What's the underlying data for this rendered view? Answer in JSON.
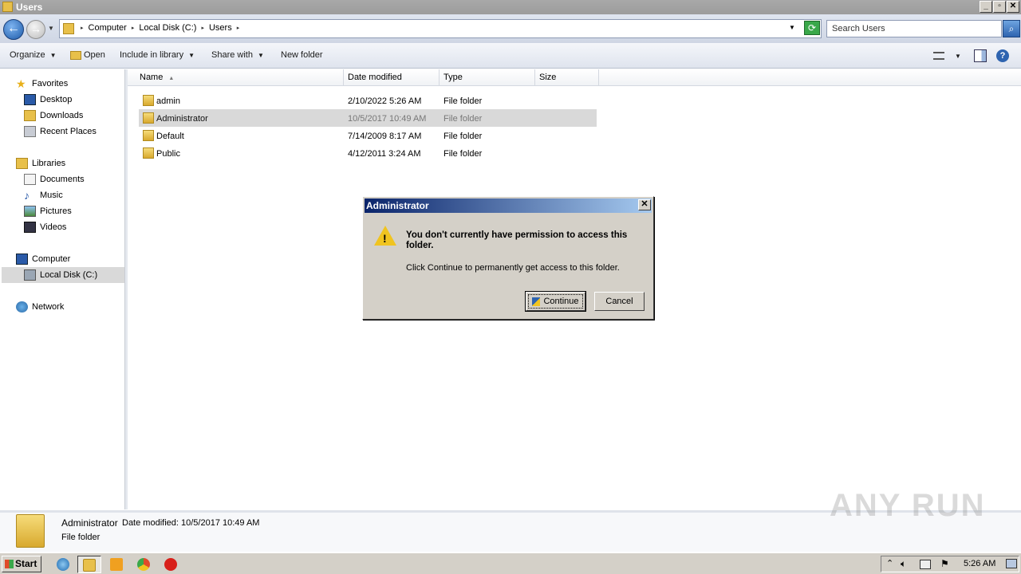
{
  "window": {
    "title": "Users"
  },
  "address": {
    "crumbs": [
      "Computer",
      "Local Disk (C:)",
      "Users"
    ]
  },
  "search": {
    "placeholder": "Search Users"
  },
  "toolbar": {
    "organize": "Organize",
    "open": "Open",
    "include_in_library": "Include in library",
    "share_with": "Share with",
    "new_folder": "New folder"
  },
  "nav": {
    "favorites": "Favorites",
    "desktop": "Desktop",
    "downloads": "Downloads",
    "recent_places": "Recent Places",
    "libraries": "Libraries",
    "documents": "Documents",
    "music": "Music",
    "pictures": "Pictures",
    "videos": "Videos",
    "computer": "Computer",
    "local_disk": "Local Disk (C:)",
    "network": "Network"
  },
  "columns": {
    "name": "Name",
    "date_modified": "Date modified",
    "type": "Type",
    "size": "Size"
  },
  "files": [
    {
      "name": "admin",
      "date": "2/10/2022 5:26 AM",
      "type": "File folder"
    },
    {
      "name": "Administrator",
      "date": "10/5/2017 10:49 AM",
      "type": "File folder"
    },
    {
      "name": "Default",
      "date": "7/14/2009 8:17 AM",
      "type": "File folder"
    },
    {
      "name": "Public",
      "date": "4/12/2011 3:24 AM",
      "type": "File folder"
    }
  ],
  "details": {
    "name": "Administrator",
    "date_label": "Date modified:",
    "date_value": "10/5/2017 10:49 AM",
    "type": "File folder"
  },
  "dialog": {
    "title": "Administrator",
    "message": "You don't currently have permission to access this folder.",
    "sub": "Click Continue to permanently get access to this folder.",
    "continue": "Continue",
    "cancel": "Cancel"
  },
  "taskbar": {
    "start": "Start",
    "clock": "5:26 AM"
  },
  "watermark": "ANY RUN"
}
